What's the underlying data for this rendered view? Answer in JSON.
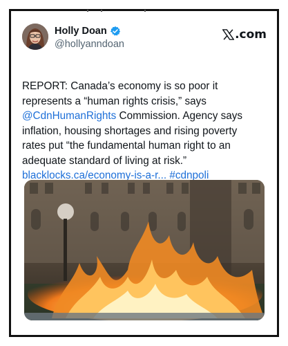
{
  "tweet": {
    "author_name": "Holly Doan",
    "handle": "@hollyanndoan",
    "brand": ".com",
    "brand_icon": "x-logo-icon",
    "verified_icon": "verified-badge-icon",
    "verified_color": "#1d9bf0",
    "text_line1": "REPORT: Canada’s economy is so poor it",
    "text_line2": "represents a “human rights crisis,” says",
    "mention": "@CdnHumanRights",
    "text_after_mention": " Commission. Agency says",
    "text_line4": "inflation, housing shortages and rising poverty",
    "text_line5": "rates put “the fundamental human right to an",
    "text_line6": "adequate standard of living at risk.”",
    "link_text": "blacklocks.ca/economy-is-a-r...",
    "hashtag": "#cdnpoli",
    "link_color": "#1d6fd8",
    "media_description_icon": "photo-flame-parliament"
  }
}
